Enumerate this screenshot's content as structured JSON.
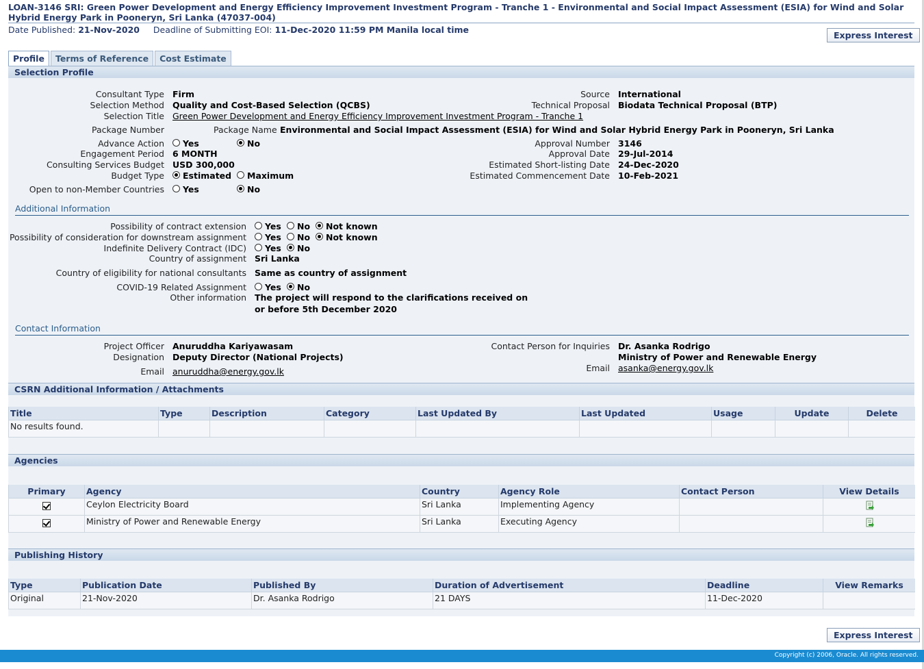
{
  "header": {
    "title": "LOAN-3146 SRI: Green Power Development and Energy Efficiency Improvement Investment Program - Tranche 1 - Environmental and Social Impact Assessment (ESIA) for Wind and Solar Hybrid Energy Park in Pooneryn, Sri Lanka (47037-004)",
    "date_published_label": "Date Published:",
    "date_published": "21-Nov-2020",
    "deadline_label": "Deadline of Submitting EOI:",
    "deadline": "11-Dec-2020 11:59 PM Manila local time",
    "express_interest": "Express Interest"
  },
  "tabs": [
    {
      "label": "Profile",
      "active": true
    },
    {
      "label": "Terms of Reference",
      "active": false
    },
    {
      "label": "Cost Estimate",
      "active": false
    }
  ],
  "selection_profile": {
    "heading": "Selection Profile",
    "consultant_type_label": "Consultant Type",
    "consultant_type": "Firm",
    "selection_method_label": "Selection Method",
    "selection_method": "Quality and Cost-Based Selection (QCBS)",
    "selection_title_label": "Selection Title",
    "selection_title": "Green Power Development and Energy Efficiency Improvement Investment Program - Tranche 1",
    "package_number_label": "Package Number",
    "package_name_label": "Package Name",
    "package_name": "Environmental and Social Impact Assessment (ESIA) for Wind and Solar Hybrid Energy Park in Pooneryn, Sri Lanka",
    "advance_action_label": "Advance Action",
    "engagement_period_label": "Engagement Period",
    "engagement_period": "6 MONTH",
    "budget_label": "Consulting Services Budget",
    "budget": "USD 300,000",
    "budget_type_label": "Budget Type",
    "budget_type_estimated": "Estimated",
    "budget_type_maximum": "Maximum",
    "open_label": "Open to non-Member Countries",
    "yes": "Yes",
    "no": "No",
    "source_label": "Source",
    "source": "International",
    "technical_proposal_label": "Technical Proposal",
    "technical_proposal": "Biodata Technical Proposal (BTP)",
    "approval_number_label": "Approval Number",
    "approval_number": "3146",
    "approval_date_label": "Approval Date",
    "approval_date": "29-Jul-2014",
    "shortlisting_label": "Estimated Short-listing Date",
    "shortlisting": "24-Dec-2020",
    "commencement_label": "Estimated Commencement Date",
    "commencement": "10-Feb-2021"
  },
  "additional_info": {
    "heading": "Additional Information",
    "extension_label": "Possibility of contract extension",
    "downstream_label": "Possibility of consideration for downstream assignment",
    "idc_label": "Indefinite Delivery Contract (IDC)",
    "country_label": "Country of assignment",
    "country": "Sri Lanka",
    "eligibility_label": "Country of eligibility for national consultants",
    "eligibility": "Same as country of assignment",
    "covid_label": "COVID-19 Related Assignment",
    "other_label": "Other information",
    "other_line1": "The project will respond to the clarifications received on",
    "other_line2": "or before 5th December 2020",
    "yes": "Yes",
    "no": "No",
    "not_known": "Not known"
  },
  "contact": {
    "heading": "Contact Information",
    "officer_label": "Project Officer",
    "officer": "Anuruddha Kariyawasam",
    "designation_label": "Designation",
    "designation": "Deputy Director (National Projects)",
    "email_label": "Email",
    "email": "anuruddha@energy.gov.lk",
    "inquiry_label": "Contact Person for Inquiries",
    "inquiry_name": "Dr. Asanka Rodrigo",
    "inquiry_org": "Ministry of Power and Renewable Energy",
    "inquiry_email_label": "Email",
    "inquiry_email": "asanka@energy.gov.lk"
  },
  "attachments": {
    "heading": "CSRN Additional Information / Attachments",
    "columns": [
      "Title",
      "Type",
      "Description",
      "Category",
      "Last Updated By",
      "Last Updated",
      "Usage",
      "Update",
      "Delete"
    ],
    "empty": "No results found."
  },
  "agencies": {
    "heading": "Agencies",
    "columns": [
      "Primary",
      "Agency",
      "Country",
      "Agency Role",
      "Contact Person",
      "View Details"
    ],
    "rows": [
      {
        "agency": "Ceylon Electricity Board",
        "country": "Sri Lanka",
        "role": "Implementing Agency",
        "contact": ""
      },
      {
        "agency": "Ministry of Power and Renewable Energy",
        "country": "Sri Lanka",
        "role": "Executing Agency",
        "contact": ""
      }
    ]
  },
  "publishing": {
    "heading": "Publishing History",
    "columns": [
      "Type",
      "Publication Date",
      "Published By",
      "Duration of Advertisement",
      "Deadline",
      "View Remarks"
    ],
    "rows": [
      {
        "type": "Original",
        "date": "21-Nov-2020",
        "by": "Dr. Asanka Rodrigo",
        "duration": "21 DAYS",
        "deadline": "11-Dec-2020",
        "remarks": ""
      }
    ]
  },
  "footer": {
    "copyright": "Copyright (c) 2006, Oracle. All rights reserved."
  }
}
